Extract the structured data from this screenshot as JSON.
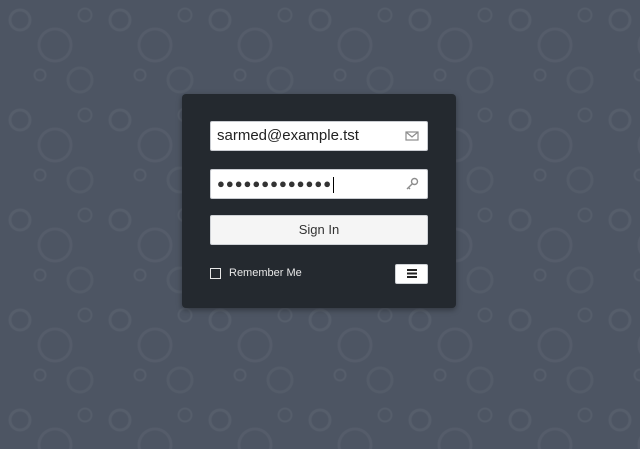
{
  "login": {
    "email_value": "sarmed@example.tst",
    "password_mask": "●●●●●●●●●●●●●",
    "signin_label": "Sign In",
    "remember_label": "Remember Me",
    "remember_checked": false
  },
  "icons": {
    "email_icon": "envelope-icon",
    "password_icon": "key-icon",
    "menu_icon": "hamburger-menu-icon"
  },
  "colors": {
    "background": "#4d5563",
    "card": "#24292f",
    "field_bg": "#ffffff",
    "button_bg": "#f5f5f5"
  }
}
